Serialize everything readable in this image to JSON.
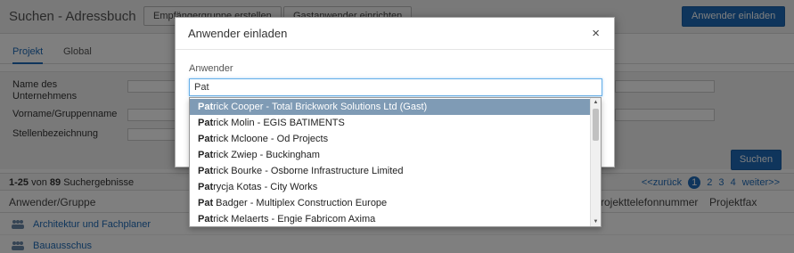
{
  "header": {
    "title": "Suchen - Adressbuch",
    "btn_create_group": "Empfängergruppe erstellen",
    "btn_setup_guest": "Gastanwender einrichten",
    "btn_invite": "Anwender einladen"
  },
  "tabs": [
    "Projekt",
    "Global"
  ],
  "form": {
    "company_label": "Name des Unternehmens",
    "name_label": "Vorname/Gruppenname",
    "position_label": "Stellenbezeichnung",
    "search_button": "Suchen"
  },
  "results": {
    "range": "1-25",
    "of_label": "von",
    "total": "89",
    "suffix": "Suchergebnisse",
    "pager": {
      "prev": "<<zurück",
      "pages": [
        "1",
        "2",
        "3",
        "4"
      ],
      "next": "weiter>>"
    }
  },
  "table": {
    "col_user": "Anwender/Gruppe",
    "col_phone": "Projekttelefonnummer",
    "col_fax": "Projektfax",
    "rows": [
      "Architektur und Fachplaner",
      "Bauausschus"
    ]
  },
  "modal": {
    "title": "Anwender einladen",
    "close": "×",
    "field_label": "Anwender",
    "input_value": "Pat"
  },
  "autocomplete": [
    {
      "match": "Pat",
      "rest": "rick Cooper - Total Brickwork Solutions Ltd (Gast)"
    },
    {
      "match": "Pat",
      "rest": "rick Molin - EGIS BATIMENTS"
    },
    {
      "match": "Pat",
      "rest": "rick Mcloone - Od Projects"
    },
    {
      "match": "Pat",
      "rest": "rick Zwiep - Buckingham"
    },
    {
      "match": "Pat",
      "rest": "rick Bourke - Osborne Infrastructure Limited"
    },
    {
      "match": "Pat",
      "rest": "rycja Kotas - City Works"
    },
    {
      "match": "Pat",
      "rest": " Badger - Multiplex Construction Europe"
    },
    {
      "match": "Pat",
      "rest": "rick Melaerts - Engie Fabricom Axima"
    }
  ],
  "colors": {
    "primary": "#1e6bb8",
    "selected_item": "#7f9bb5"
  }
}
